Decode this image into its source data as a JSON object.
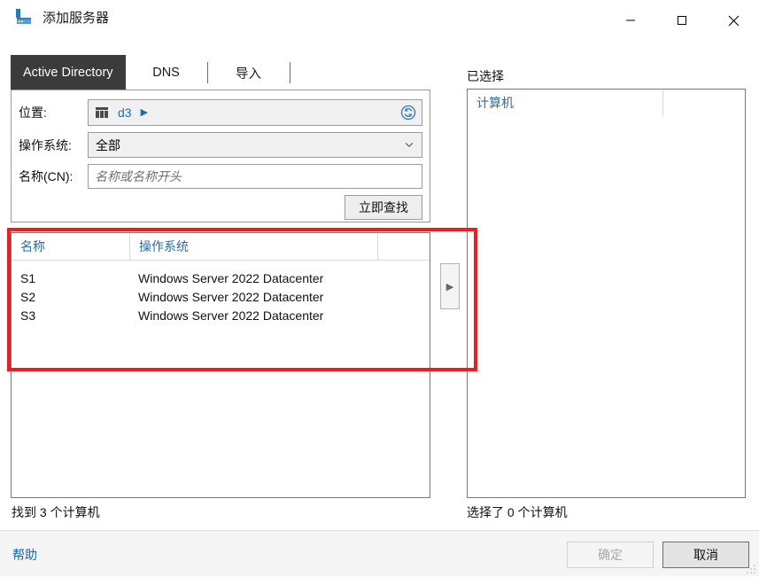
{
  "window": {
    "title": "添加服务器",
    "icon": "server-icon",
    "minimize": "—",
    "maximize": "□",
    "close": "✕"
  },
  "tabs": [
    {
      "label": "Active Directory",
      "active": true
    },
    {
      "label": "DNS",
      "active": false
    },
    {
      "label": "导入",
      "active": false
    }
  ],
  "query": {
    "location_label": "位置:",
    "location_value": "d3",
    "location_arrow": "▶",
    "refresh_icon": "refresh-icon",
    "os_label": "操作系统:",
    "os_value": "全部",
    "os_caret": "⌄",
    "cn_label": "名称(CN):",
    "cn_value": "",
    "cn_placeholder": "名称或名称开头",
    "find_now": "立即查找"
  },
  "results": {
    "columns": [
      "名称",
      "操作系统",
      ""
    ],
    "rows": [
      {
        "name": "S1",
        "os": "Windows Server 2022 Datacenter"
      },
      {
        "name": "S2",
        "os": "Windows Server 2022 Datacenter"
      },
      {
        "name": "S3",
        "os": "Windows Server 2022 Datacenter"
      }
    ],
    "status": "找到 3 个计算机"
  },
  "move_button": {
    "glyph": "▶"
  },
  "selected": {
    "label": "已选择",
    "columns": [
      "计算机",
      ""
    ],
    "rows": [],
    "status": "选择了 0 个计算机"
  },
  "footer": {
    "help": "帮助",
    "ok": "确定",
    "cancel": "取消"
  },
  "colors": {
    "accent_blue": "#1e6bb8",
    "header_blue": "#2b6ca3",
    "active_tab_bg": "#3b3b3b",
    "annotation_red": "#e8201e",
    "footer_bg": "#f5f5f5"
  }
}
